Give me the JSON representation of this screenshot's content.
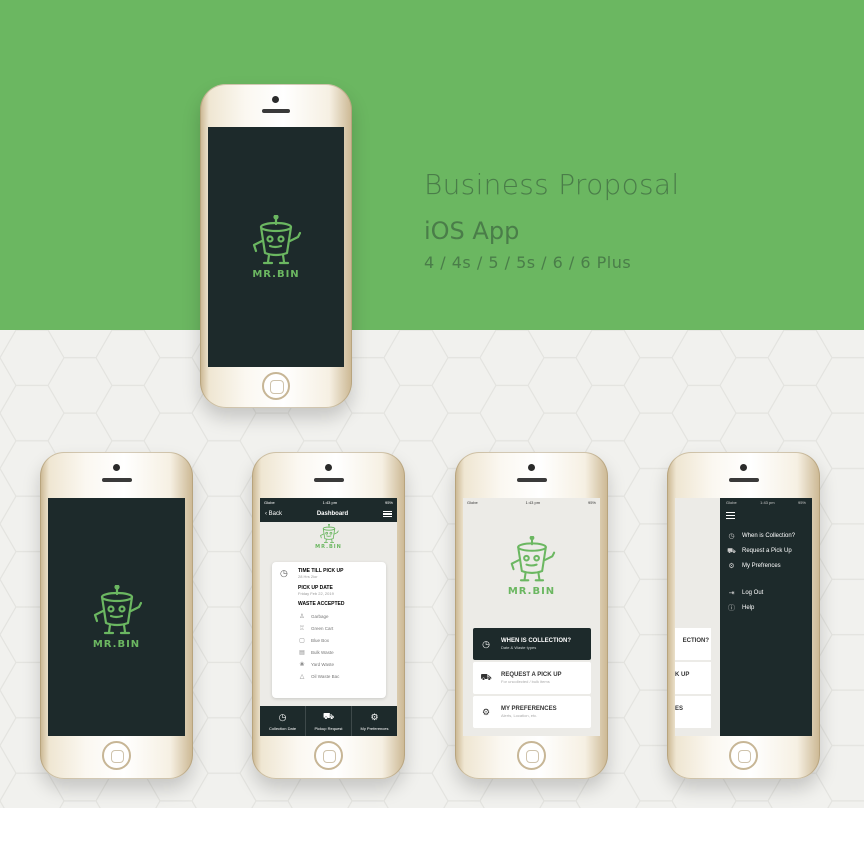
{
  "colors": {
    "green": "#6bb761",
    "dark": "#1d2a2b",
    "title": "#4a7d49"
  },
  "header": {
    "title": "Business Proposal",
    "subtitle": "iOS App",
    "models": "4 / 4s / 5 / 5s / 6 / 6 Plus"
  },
  "logo": {
    "text": "MR.BIN",
    "icon": "robot-bin-icon"
  },
  "status_bar": {
    "carrier": "Globe",
    "time": "1:43 pm",
    "battery": "95%"
  },
  "dashboard": {
    "back_label": "Back",
    "title": "Dashboard",
    "time_till_label": "TIME TILL PICK UP",
    "time_till_value": "28 Hrs 2ior",
    "pickup_date_label": "PICK UP DATE",
    "pickup_date_value": "Friday Feb 22, 2019",
    "waste_label": "WASTE ACCEPTED",
    "waste_items": [
      {
        "label": "Garbage",
        "icon": "trash-icon"
      },
      {
        "label": "Green Cart",
        "icon": "cart-icon"
      },
      {
        "label": "Blue Box",
        "icon": "box-icon"
      },
      {
        "label": "Bulk Waste",
        "icon": "bulk-icon"
      },
      {
        "label": "Yard Waste",
        "icon": "leaf-icon"
      },
      {
        "label": "Oil Waste Bac",
        "icon": "warning-icon"
      }
    ],
    "tabs": [
      {
        "label": "Collection Date",
        "icon": "clock-icon"
      },
      {
        "label": "Pickup Request",
        "icon": "truck-icon"
      },
      {
        "label": "My Preferences",
        "icon": "gear-icon"
      }
    ]
  },
  "home_menu": [
    {
      "title": "WHEN IS COLLECTION?",
      "sub": "Date & Waste types",
      "icon": "clock-icon"
    },
    {
      "title": "REQUEST A PICK UP",
      "sub": "For uncollected / bulk items",
      "icon": "truck-icon"
    },
    {
      "title": "MY PREFERENCES",
      "sub": "Alerts, Location, etc.",
      "icon": "gear-icon"
    }
  ],
  "drawer": {
    "items": [
      {
        "label": "When is Collection?",
        "icon": "clock-icon"
      },
      {
        "label": "Request a Pick Up",
        "icon": "truck-icon"
      },
      {
        "label": "My Prefrences",
        "icon": "gear-icon"
      }
    ],
    "secondary": [
      {
        "label": "Log Out",
        "icon": "logout-icon"
      },
      {
        "label": "Help",
        "icon": "help-icon"
      }
    ],
    "peek": [
      "ECTION?",
      "K UP",
      "ES"
    ]
  }
}
